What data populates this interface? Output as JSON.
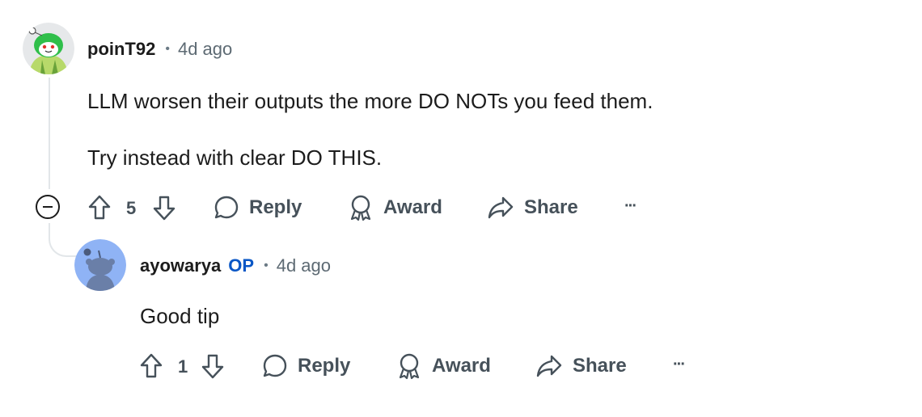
{
  "comment1": {
    "author": "poinT92",
    "separator": "•",
    "time": "4d ago",
    "body_line1": "LLM worsen their outputs the more DO NOTs you feed them.",
    "body_line2": "Try instead with clear DO THIS.",
    "vote_count": "5",
    "reply_label": "Reply",
    "award_label": "Award",
    "share_label": "Share",
    "more_label": "···"
  },
  "comment2": {
    "author": "ayowarya",
    "op_badge": "OP",
    "separator": "•",
    "time": "4d ago",
    "body": "Good tip",
    "vote_count": "1",
    "reply_label": "Reply",
    "award_label": "Award",
    "share_label": "Share",
    "more_label": "···"
  },
  "colors": {
    "op_blue": "#0a57c6",
    "action_gray": "#46515a",
    "thread_line": "#e2e6e9",
    "avatar2_bg": "#8fb3f5"
  },
  "icons": [
    "snoo-avatar-green-icon",
    "snoo-avatar-blue-icon",
    "upvote-icon",
    "downvote-icon",
    "reply-bubble-icon",
    "award-icon",
    "share-arrow-icon",
    "collapse-icon",
    "more-options-icon"
  ]
}
